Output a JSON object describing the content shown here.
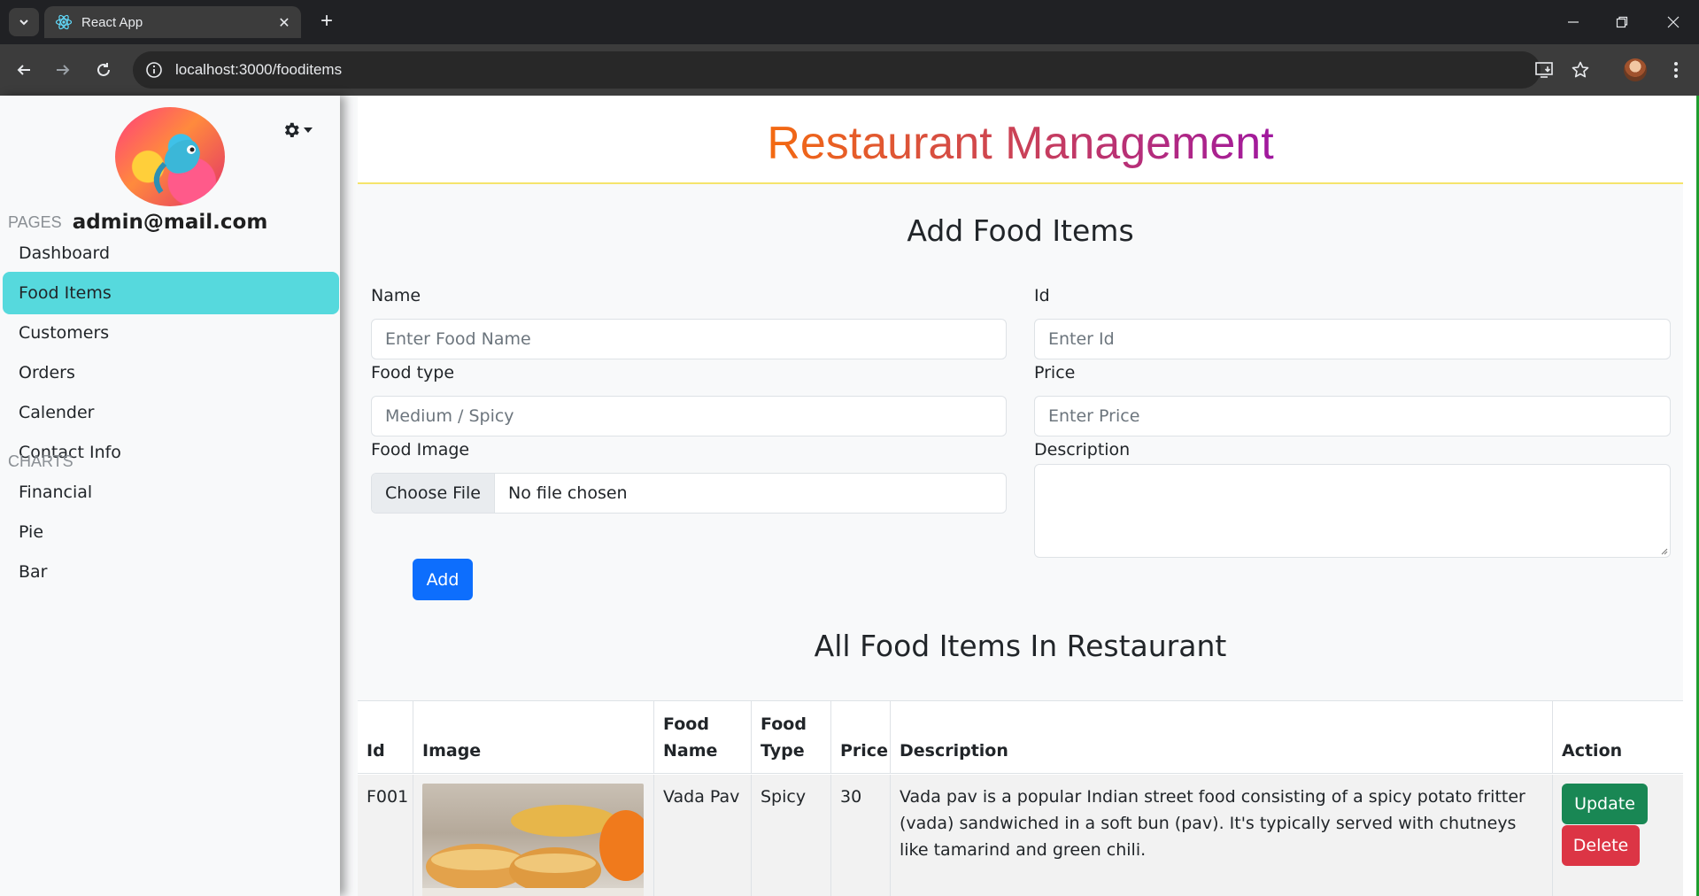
{
  "browser": {
    "tab_title": "React App",
    "url": "localhost:3000/fooditems"
  },
  "sidebar": {
    "email": "admin@mail.com",
    "pages_label": "PAGES",
    "charts_label": "CHARTS",
    "pages": [
      {
        "label": "Dashboard"
      },
      {
        "label": "Food Items",
        "active": true
      },
      {
        "label": "Customers"
      },
      {
        "label": "Orders"
      },
      {
        "label": "Calender"
      },
      {
        "label": "Contact Info"
      }
    ],
    "charts": [
      {
        "label": "Financial"
      },
      {
        "label": "Pie"
      },
      {
        "label": "Bar"
      }
    ]
  },
  "header": {
    "title": "Restaurant Management",
    "gradient_from": "#f46a10",
    "gradient_to": "#a0189f"
  },
  "form": {
    "title": "Add Food Items",
    "name_label": "Name",
    "name_placeholder": "Enter Food Name",
    "id_label": "Id",
    "id_placeholder": "Enter Id",
    "type_label": "Food type",
    "type_placeholder": "Medium / Spicy",
    "price_label": "Price",
    "price_placeholder": "Enter Price",
    "image_label": "Food Image",
    "file_button": "Choose File",
    "file_status": "No file chosen",
    "description_label": "Description",
    "add_button": "Add"
  },
  "table": {
    "title": "All Food Items In Restaurant",
    "headers": {
      "id": "Id",
      "image": "Image",
      "food_name_1": "Food",
      "food_name_2": "Name",
      "food_type_1": "Food",
      "food_type_2": "Type",
      "price": "Price",
      "description": "Description",
      "action": "Action"
    },
    "rows": [
      {
        "id": "F001",
        "name": "Vada Pav",
        "type": "Spicy",
        "price": "30",
        "description": "Vada pav is a popular Indian street food consisting of a spicy potato fritter (vada) sandwiched in a soft bun (pav). It's typically served with chutneys like tamarind and green chili.",
        "update_label": "Update",
        "delete_label": "Delete"
      }
    ]
  },
  "colors": {
    "active_nav": "#56d9dd",
    "primary": "#0d6efd",
    "success": "#198754",
    "danger": "#dc3545"
  }
}
